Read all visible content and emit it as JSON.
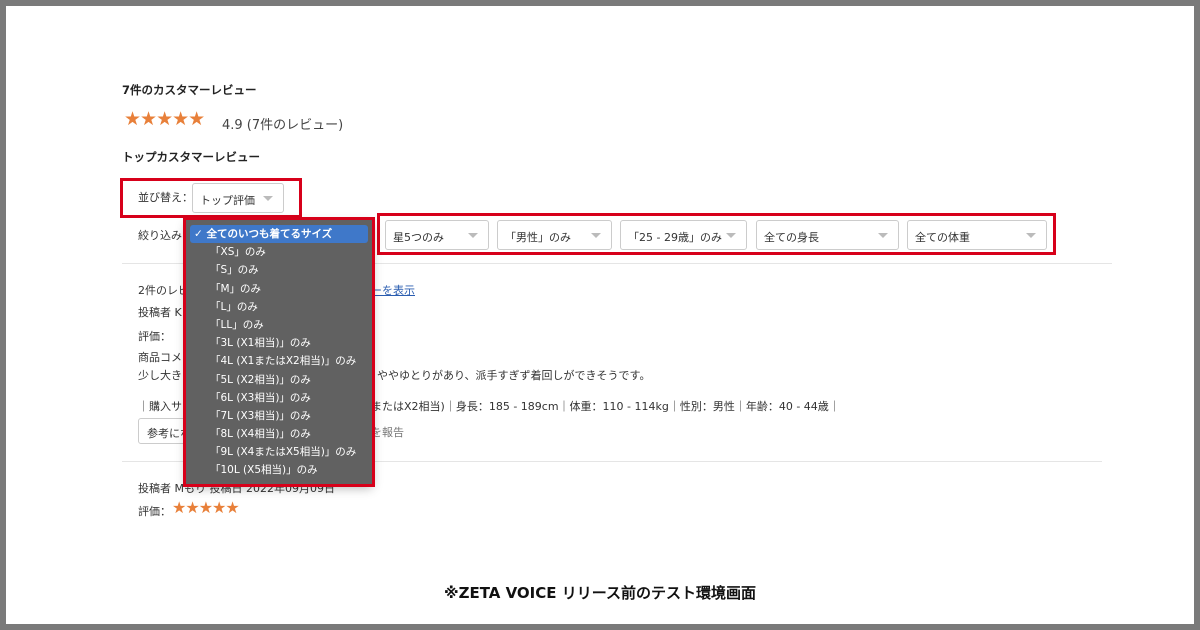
{
  "reviews_header": {
    "title": "7件のカスタマーレビュー",
    "rating": "4.9 (7件のレビュー)",
    "stars": "★★★★★"
  },
  "top_reviews_title": "トップカスタマーレビュー",
  "sort": {
    "label": "並び替え：",
    "value": "トップ評価"
  },
  "filter": {
    "label": "絞り込み",
    "size_options": [
      "全てのいつも着てるサイズ",
      "「XS」のみ",
      "「S」のみ",
      "「M」のみ",
      "「L」のみ",
      "「LL」のみ",
      "「3L (X1相当)」のみ",
      "「4L (X1またはX2相当)」のみ",
      "「5L (X2相当)」のみ",
      "「6L (X3相当)」のみ",
      "「7L (X3相当)」のみ",
      "「8L (X4相当)」のみ",
      "「9L (X4またはX5相当)」のみ",
      "「10L (X5相当)」のみ"
    ],
    "selected_size": "全てのいつも着てるサイズ",
    "selects": [
      "星5つのみ",
      "「男性」のみ",
      "「25 - 29歳」のみ",
      "全ての身長",
      "全ての体重"
    ]
  },
  "review1": {
    "count_prefix": "2件のレビ",
    "show_link": "ーを表示",
    "author": "投稿者 K",
    "rating_label": "評価：",
    "comment_label": "商品コメ",
    "comment_start": "少し大き",
    "comment_end": "ややゆとりがあり、派手すぎず着回しができそうです。",
    "attrs_start": "｜購入サ",
    "attrs_end": "またはX2相当)｜身長：185 - 189cm｜体重：110 - 114kg｜性別：男性｜年齢：40 - 44歳｜",
    "helpful_button": "参考にな",
    "report_link": "を報告"
  },
  "review2": {
    "author_date": "投稿者 Mもり 投稿日 2022年09月09日",
    "rating_label": "評価：",
    "stars": "★★★★★"
  },
  "caption": "※ZETA VOICE リリース前のテスト環境画面",
  "colors": {
    "highlight": "#d7001a",
    "star": "#e8803a",
    "dropdown_bg": "#616161",
    "selected": "#3f78c9"
  }
}
